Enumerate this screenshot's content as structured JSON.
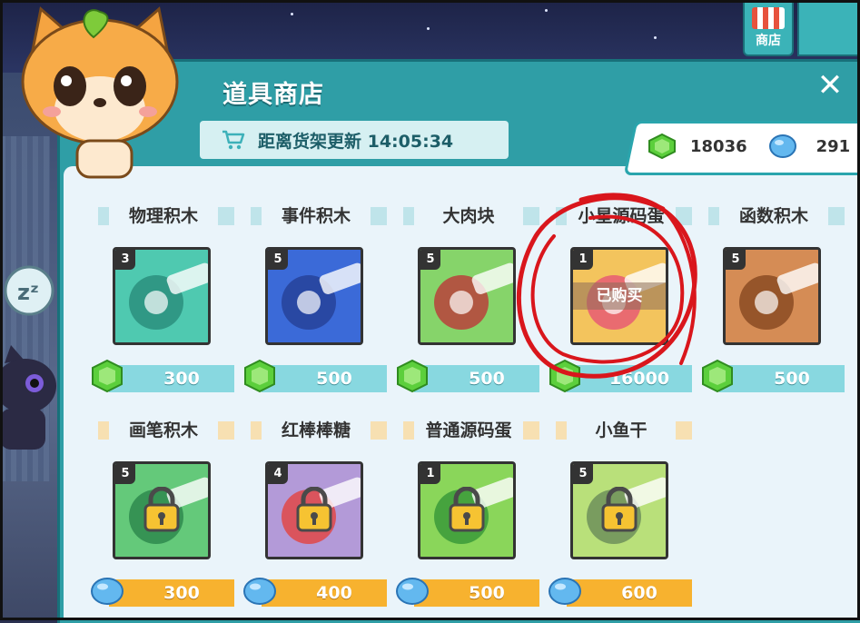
{
  "header": {
    "title": "道具商店",
    "refresh_label": "距离货架更新 14:05:34",
    "close_icon": "close-icon"
  },
  "top_nav": {
    "shop_label": "商店"
  },
  "currency": {
    "green_gems": "18036",
    "blue_gems": "291"
  },
  "items": [
    {
      "name": "物理积木",
      "level": "3",
      "price": "300",
      "currency": "green-gem",
      "locked": false,
      "bought": false,
      "theme": "#4fc9b0",
      "accent": "#2a8f7e"
    },
    {
      "name": "事件积木",
      "level": "5",
      "price": "500",
      "currency": "green-gem",
      "locked": false,
      "bought": false,
      "theme": "#3b6ad8",
      "accent": "#27429a"
    },
    {
      "name": "大肉块",
      "level": "5",
      "price": "500",
      "currency": "green-gem",
      "locked": false,
      "bought": false,
      "theme": "#86d46a",
      "accent": "#b9413b"
    },
    {
      "name": "小星源码蛋",
      "level": "1",
      "price": "16000",
      "currency": "green-gem",
      "locked": false,
      "bought": true,
      "bought_label": "已购买",
      "theme": "#f3c45d",
      "accent": "#e65c73"
    },
    {
      "name": "函数积木",
      "level": "5",
      "price": "500",
      "currency": "green-gem",
      "locked": false,
      "bought": false,
      "theme": "#d58c55",
      "accent": "#8b4b23"
    },
    {
      "name": "画笔积木",
      "level": "5",
      "price": "300",
      "currency": "blue-gem",
      "locked": true,
      "bought": false,
      "theme": "#64c97a",
      "accent": "#2e8a4e"
    },
    {
      "name": "红棒棒糖",
      "level": "4",
      "price": "400",
      "currency": "blue-gem",
      "locked": true,
      "bought": false,
      "theme": "#b39ad8",
      "accent": "#e04848"
    },
    {
      "name": "普通源码蛋",
      "level": "1",
      "price": "500",
      "currency": "blue-gem",
      "locked": true,
      "bought": false,
      "theme": "#8ad65a",
      "accent": "#3a9a3a"
    },
    {
      "name": "小鱼干",
      "level": "5",
      "price": "600",
      "currency": "blue-gem",
      "locked": true,
      "bought": false,
      "theme": "#b9e07a",
      "accent": "#6d8f5a"
    }
  ]
}
